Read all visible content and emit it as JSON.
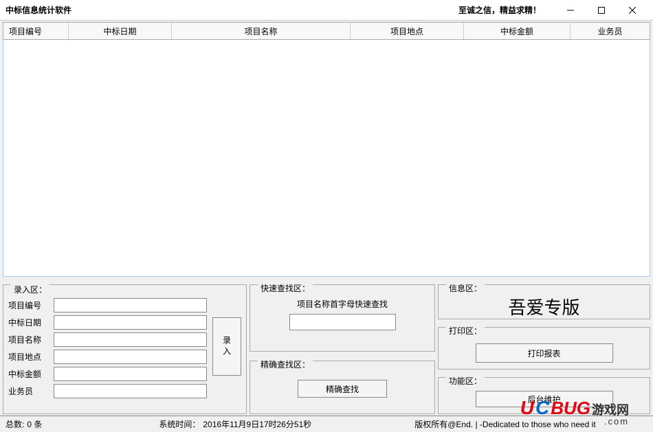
{
  "titlebar": {
    "title": "中标信息统计软件",
    "slogan": "至诚之信，精益求精！"
  },
  "table": {
    "columns": [
      "项目编号",
      "中标日期",
      "项目名称",
      "项目地点",
      "中标金额",
      "业务员"
    ]
  },
  "inputPanel": {
    "label": "录入区：",
    "fields": [
      {
        "label": "项目编号",
        "value": ""
      },
      {
        "label": "中标日期",
        "value": ""
      },
      {
        "label": "项目名称",
        "value": ""
      },
      {
        "label": "项目地点",
        "value": ""
      },
      {
        "label": "中标金额",
        "value": ""
      },
      {
        "label": "业务员",
        "value": ""
      }
    ],
    "submit": "录入"
  },
  "quickSearch": {
    "label": "快速查找区：",
    "text": "项目名称首字母快速查找",
    "value": ""
  },
  "exactSearch": {
    "label": "精确查找区：",
    "button": "精确查找"
  },
  "infoPanel": {
    "label": "信息区：",
    "text": "吾爱专版"
  },
  "printPanel": {
    "label": "打印区：",
    "button": "打印报表"
  },
  "funcPanel": {
    "label": "功能区：",
    "button": "后台维护"
  },
  "statusbar": {
    "totalLabel": "总数:",
    "totalValue": "0 条",
    "timeLabel": "系统时间：",
    "timeValue": "2016年11月9日17时26分51秒",
    "copyright": "版权所有@End.  |  -Dedicated to those who need it"
  },
  "watermark": {
    "text1": "UCBUG",
    "text2": "游戏网",
    "text3": ".com"
  }
}
